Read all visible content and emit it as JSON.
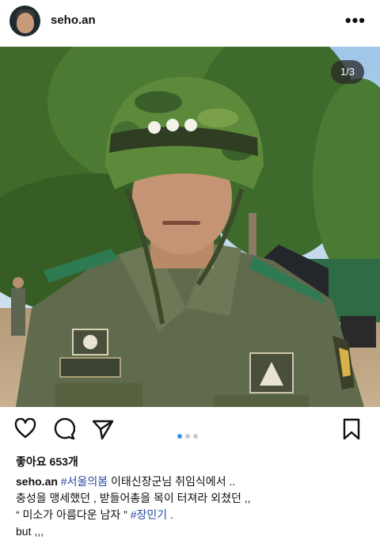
{
  "post": {
    "username": "seho.an",
    "more_label": "•••",
    "image_counter": "1/3",
    "image_alt": "soldier in green helmet and uniform",
    "actions": [
      {
        "name": "like",
        "icon": "heart-icon"
      },
      {
        "name": "comment",
        "icon": "comment-icon"
      },
      {
        "name": "share",
        "icon": "paper-plane-icon"
      },
      {
        "name": "save",
        "icon": "bookmark-icon"
      }
    ],
    "carousel_dots": 3,
    "carousel_active": 1,
    "likes": "좋아요 653개",
    "caption": {
      "user": "seho.an",
      "hashtag1": "#서울의봄",
      "line1_rest": " 이태신장군님 취임식에서 ..",
      "line2": "충성을 맹세했던 , 받들어총을 목이 터져라 외쳤던 ,,",
      "line3_pre": "“ 미소가 아름다운 남자 ” ",
      "hashtag2": "#장민기",
      "line3_post": " .",
      "line4": "but ,,,"
    }
  }
}
